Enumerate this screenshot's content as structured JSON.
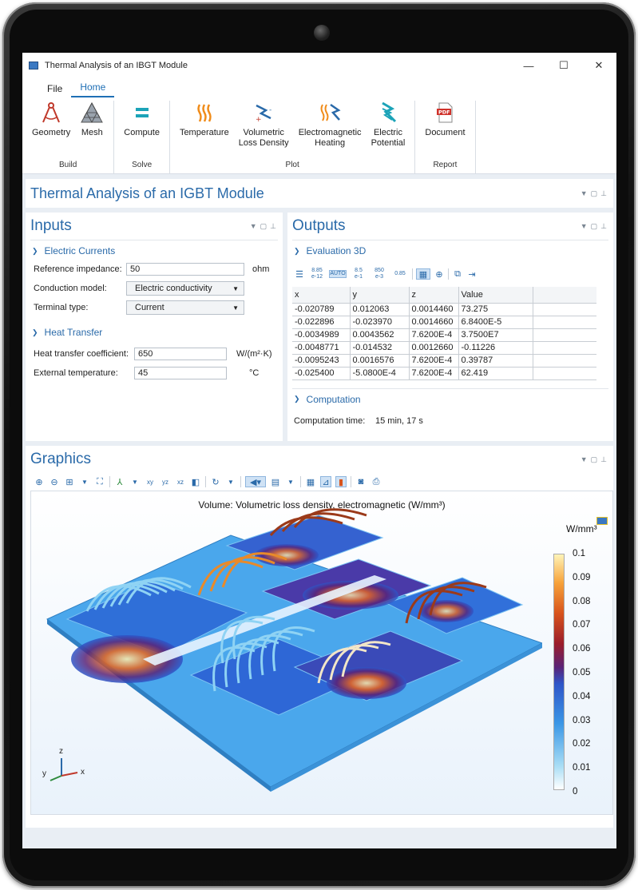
{
  "window": {
    "title": "Thermal Analysis of an IBGT Module",
    "min": "—",
    "max": "☐",
    "close": "✕"
  },
  "menu": {
    "file": "File",
    "home": "Home"
  },
  "ribbon": {
    "build": {
      "label": "Build",
      "geometry": "Geometry",
      "mesh": "Mesh"
    },
    "solve": {
      "label": "Solve",
      "compute": "Compute"
    },
    "plot": {
      "label": "Plot",
      "temperature": "Temperature",
      "volumetric_1": "Volumetric",
      "volumetric_2": "Loss Density",
      "electromagnetic_1": "Electromagnetic",
      "electromagnetic_2": "Heating",
      "electric_1": "Electric",
      "electric_2": "Potential"
    },
    "report": {
      "label": "Report",
      "document": "Document"
    }
  },
  "app_title": "Thermal Analysis of an IGBT Module",
  "inputs": {
    "title": "Inputs",
    "electric_currents": {
      "heading": "Electric Currents",
      "reference_impedance_label": "Reference impedance:",
      "reference_impedance_value": "50",
      "reference_impedance_unit": "ohm",
      "conduction_model_label": "Conduction model:",
      "conduction_model_value": "Electric conductivity",
      "terminal_type_label": "Terminal type:",
      "terminal_type_value": "Current"
    },
    "heat_transfer": {
      "heading": "Heat Transfer",
      "htc_label": "Heat transfer coefficient:",
      "htc_value": "650",
      "htc_unit": "W/(m²·K)",
      "ext_temp_label": "External temperature:",
      "ext_temp_value": "45",
      "ext_temp_unit": "°C"
    }
  },
  "outputs": {
    "title": "Outputs",
    "evaluation": {
      "heading": "Evaluation 3D",
      "toolbar": {
        "prec1_a": "8.85",
        "prec1_b": "e-12",
        "auto": "AUTO",
        "prec2_a": "8.5",
        "prec2_b": "e-1",
        "prec3_a": "850",
        "prec3_b": "e-3",
        "prec4": "0.85"
      },
      "columns": [
        "x",
        "y",
        "z",
        "Value"
      ],
      "rows": [
        [
          "-0.020789",
          "0.012063",
          "0.0014460",
          "73.275"
        ],
        [
          "-0.022896",
          "-0.023970",
          "0.0014660",
          "6.8400E-5"
        ],
        [
          "-0.0034989",
          "0.0043562",
          "7.6200E-4",
          "3.7500E7"
        ],
        [
          "-0.0048771",
          "-0.014532",
          "0.0012660",
          "-0.11226"
        ],
        [
          "-0.0095243",
          "0.0016576",
          "7.6200E-4",
          "0.39787"
        ],
        [
          "-0.025400",
          "-5.0800E-4",
          "7.6200E-4",
          "62.419"
        ]
      ]
    },
    "computation": {
      "heading": "Computation",
      "label": "Computation time:",
      "value": "15 min, 17 s"
    }
  },
  "graphics": {
    "title": "Graphics",
    "plot_title": "Volume: Volumetric loss density, electromagnetic (W/mm³)",
    "colorbar_unit": "W/mm³",
    "colorbar_ticks": [
      "0.1",
      "0.09",
      "0.08",
      "0.07",
      "0.06",
      "0.05",
      "0.04",
      "0.03",
      "0.02",
      "0.01",
      "0"
    ],
    "axes": {
      "x": "x",
      "y": "y",
      "z": "z"
    }
  }
}
